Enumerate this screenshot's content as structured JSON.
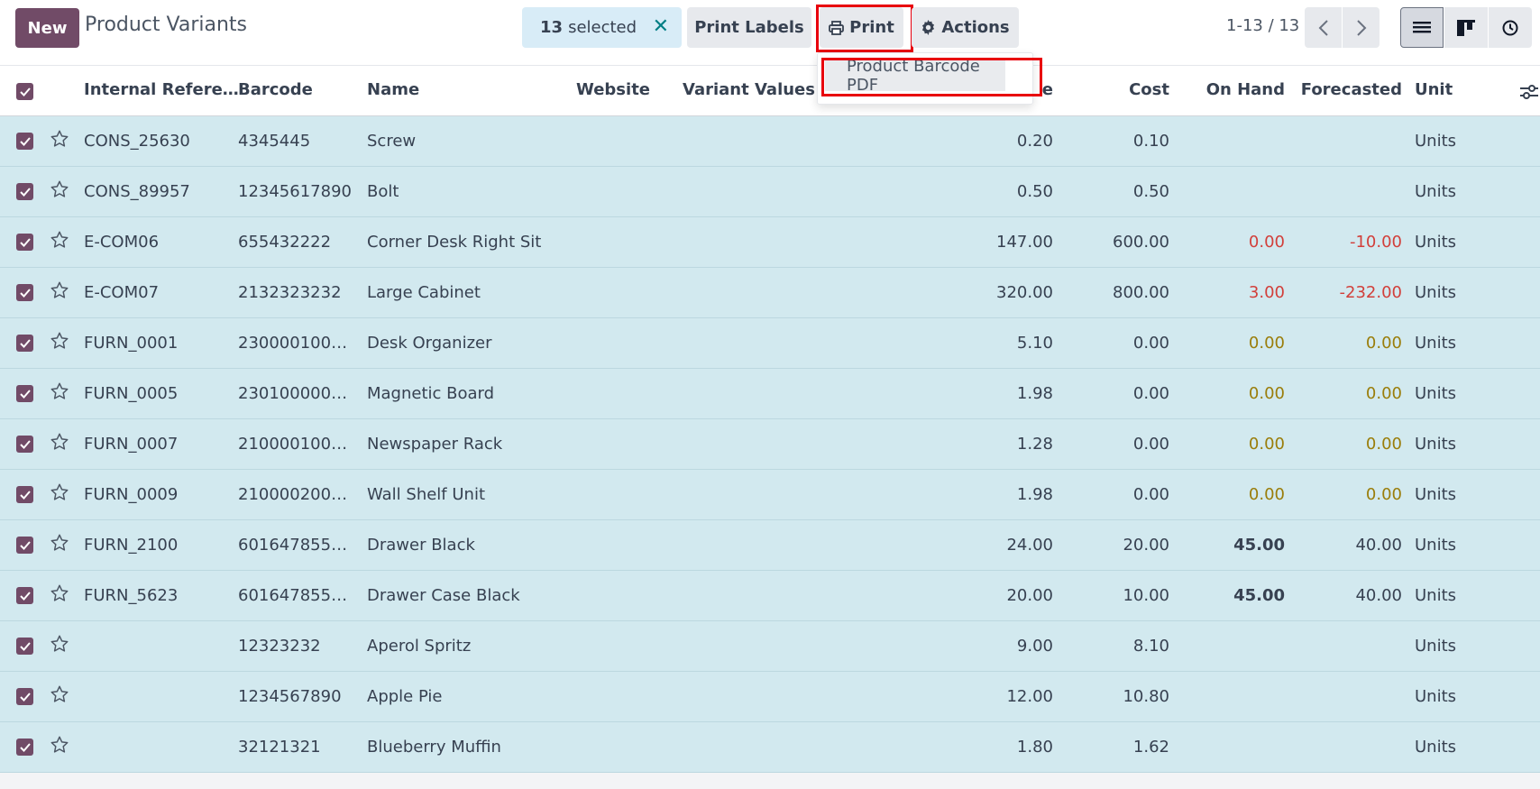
{
  "header": {
    "new_label": "New",
    "title": "Product Variants",
    "selected_count": "13",
    "selected_text": "selected",
    "print_labels": "Print Labels",
    "print": "Print",
    "actions": "Actions",
    "pager": "1-13 / 13"
  },
  "print_menu": {
    "items": [
      "Product Barcode PDF"
    ]
  },
  "columns": {
    "internal_ref": "Internal Refere…",
    "barcode": "Barcode",
    "name": "Name",
    "website": "Website",
    "variant_values": "Variant Values",
    "price": "e",
    "cost": "Cost",
    "on_hand": "On Hand",
    "forecasted": "Forecasted",
    "unit": "Unit"
  },
  "rows": [
    {
      "ref": "CONS_25630",
      "barcode": "4345445",
      "name": "Screw",
      "price": "0.20",
      "cost": "0.10",
      "on_hand": "",
      "forecasted": "",
      "unit": "Units"
    },
    {
      "ref": "CONS_89957",
      "barcode": "12345617890",
      "name": "Bolt",
      "price": "0.50",
      "cost": "0.50",
      "on_hand": "",
      "forecasted": "",
      "unit": "Units"
    },
    {
      "ref": "E-COM06",
      "barcode": "655432222",
      "name": "Corner Desk Right Sit",
      "price": "147.00",
      "cost": "600.00",
      "on_hand": "0.00",
      "forecasted": "-10.00",
      "unit": "Units"
    },
    {
      "ref": "E-COM07",
      "barcode": "2132323232",
      "name": "Large Cabinet",
      "price": "320.00",
      "cost": "800.00",
      "on_hand": "3.00",
      "forecasted": "-232.00",
      "unit": "Units"
    },
    {
      "ref": "FURN_0001",
      "barcode": "230000100…",
      "name": "Desk Organizer",
      "price": "5.10",
      "cost": "0.00",
      "on_hand": "0.00",
      "forecasted": "0.00",
      "unit": "Units"
    },
    {
      "ref": "FURN_0005",
      "barcode": "230100000…",
      "name": "Magnetic Board",
      "price": "1.98",
      "cost": "0.00",
      "on_hand": "0.00",
      "forecasted": "0.00",
      "unit": "Units"
    },
    {
      "ref": "FURN_0007",
      "barcode": "210000100…",
      "name": "Newspaper Rack",
      "price": "1.28",
      "cost": "0.00",
      "on_hand": "0.00",
      "forecasted": "0.00",
      "unit": "Units"
    },
    {
      "ref": "FURN_0009",
      "barcode": "210000200…",
      "name": "Wall Shelf Unit",
      "price": "1.98",
      "cost": "0.00",
      "on_hand": "0.00",
      "forecasted": "0.00",
      "unit": "Units"
    },
    {
      "ref": "FURN_2100",
      "barcode": "601647855…",
      "name": "Drawer Black",
      "price": "24.00",
      "cost": "20.00",
      "on_hand": "45.00",
      "forecasted": "40.00",
      "unit": "Units"
    },
    {
      "ref": "FURN_5623",
      "barcode": "601647855…",
      "name": "Drawer Case Black",
      "price": "20.00",
      "cost": "10.00",
      "on_hand": "45.00",
      "forecasted": "40.00",
      "unit": "Units"
    },
    {
      "ref": "",
      "barcode": "12323232",
      "name": "Aperol Spritz",
      "price": "9.00",
      "cost": "8.10",
      "on_hand": "",
      "forecasted": "",
      "unit": "Units"
    },
    {
      "ref": "",
      "barcode": "1234567890",
      "name": "Apple Pie",
      "price": "12.00",
      "cost": "10.80",
      "on_hand": "",
      "forecasted": "",
      "unit": "Units"
    },
    {
      "ref": "",
      "barcode": "32121321",
      "name": "Blueberry Muffin",
      "price": "1.80",
      "cost": "1.62",
      "on_hand": "",
      "forecasted": "",
      "unit": "Units"
    }
  ],
  "colors": {
    "brand": "#714b67",
    "selected_row": "#d2e9ef",
    "negative": "#d23f3a",
    "warning": "#9a7d0a",
    "highlight": "#e8000d"
  }
}
